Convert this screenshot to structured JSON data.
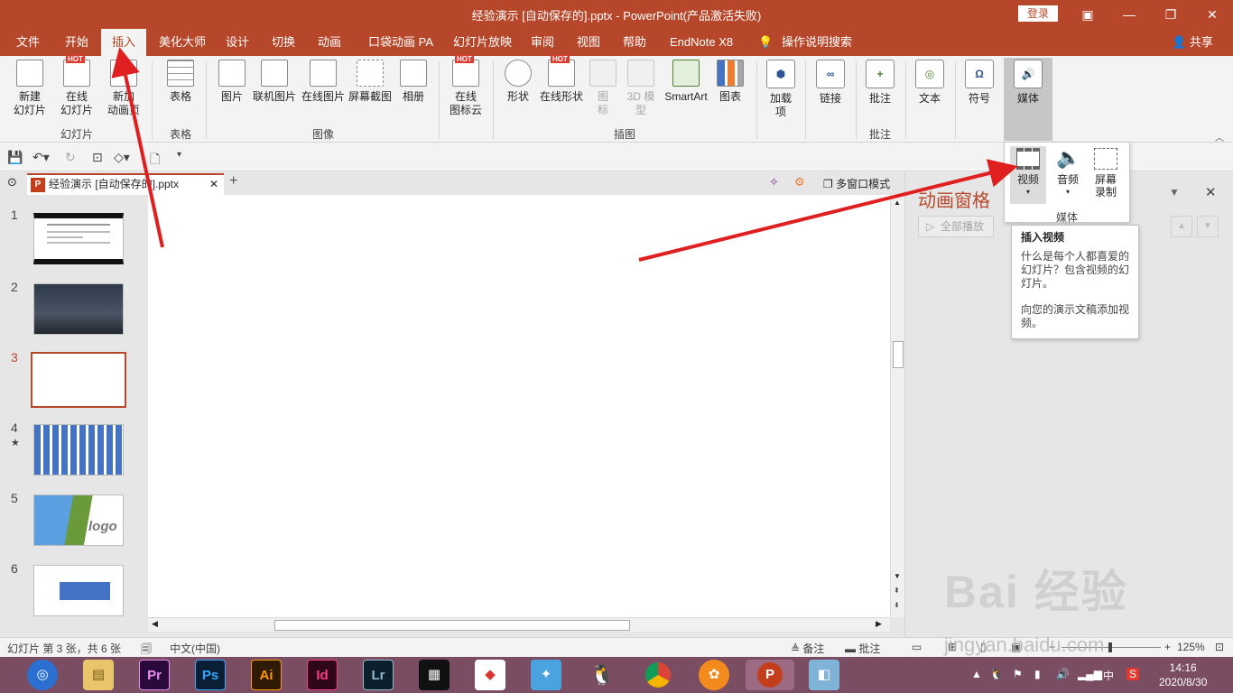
{
  "window": {
    "title": "经验演示 [自动保存的].pptx  -  PowerPoint(产品激活失败)",
    "login": "登录",
    "controls": [
      "▣",
      "—",
      "❐",
      "✕"
    ]
  },
  "tabs": [
    "文件",
    "开始",
    "插入",
    "美化大师",
    "设计",
    "切换",
    "动画",
    "口袋动画 PA",
    "幻灯片放映",
    "审阅",
    "视图",
    "帮助",
    "EndNote X8",
    "操作说明搜索"
  ],
  "share": "共享",
  "ribbon": {
    "slides": {
      "new": "新建\n幻灯片",
      "online": "在线\n幻灯片",
      "anim_page": "新加\n动画页",
      "group": "幻灯片"
    },
    "table": {
      "table": "表格",
      "group": "表格"
    },
    "images": {
      "picture": "图片",
      "linked": "联机图片",
      "online": "在线图片",
      "screenshot": "屏幕截图",
      "album": "相册",
      "group": "图像"
    },
    "icons_cloud": "在线\n图标云",
    "illus": {
      "shapes": "形状",
      "online_shapes": "在线形状",
      "icons": "图\n标",
      "model3d": "3D 模\n型",
      "smartart": "SmartArt",
      "chart": "图表",
      "group": "插图"
    },
    "addins": "加载\n项",
    "link": "链接",
    "comment": {
      "label": "批注",
      "group": "批注"
    },
    "text": "文本",
    "symbol": "符号",
    "media": "媒体",
    "hot": "HOT"
  },
  "doc_tab": {
    "name": "经验演示 [自动保存的].pptx",
    "multiwindow": "多窗口模式"
  },
  "thumbnails": [
    {
      "num": "1"
    },
    {
      "num": "2"
    },
    {
      "num": "3"
    },
    {
      "num": "4",
      "star": "★"
    },
    {
      "num": "5",
      "logo": "logo"
    },
    {
      "num": "6"
    }
  ],
  "anim_pane": {
    "title": "动画窗格",
    "play_all": "全部播放"
  },
  "media_dropdown": {
    "video": "视频",
    "audio": "音频",
    "screen_rec": "屏幕\n录制",
    "group": "媒体"
  },
  "tooltip": {
    "title": "插入视频",
    "line1": "什么是每个人都喜爱的幻灯片？包含视频的幻灯片。",
    "line2": "向您的演示文稿添加视频。"
  },
  "status": {
    "slide_info": "幻灯片 第 3 张，共 6 张",
    "lang": "中文(中国)",
    "notes": "备注",
    "comments": "批注",
    "zoom": "125%"
  },
  "taskbar": {
    "apps": [
      "Pr",
      "Ps",
      "Ai",
      "Id",
      "Lr"
    ],
    "time": "14:16",
    "date": "2020/8/30",
    "ime": "中"
  },
  "watermark": {
    "brand": "Bai 经验",
    "url": "jingyan.baidu.com"
  }
}
